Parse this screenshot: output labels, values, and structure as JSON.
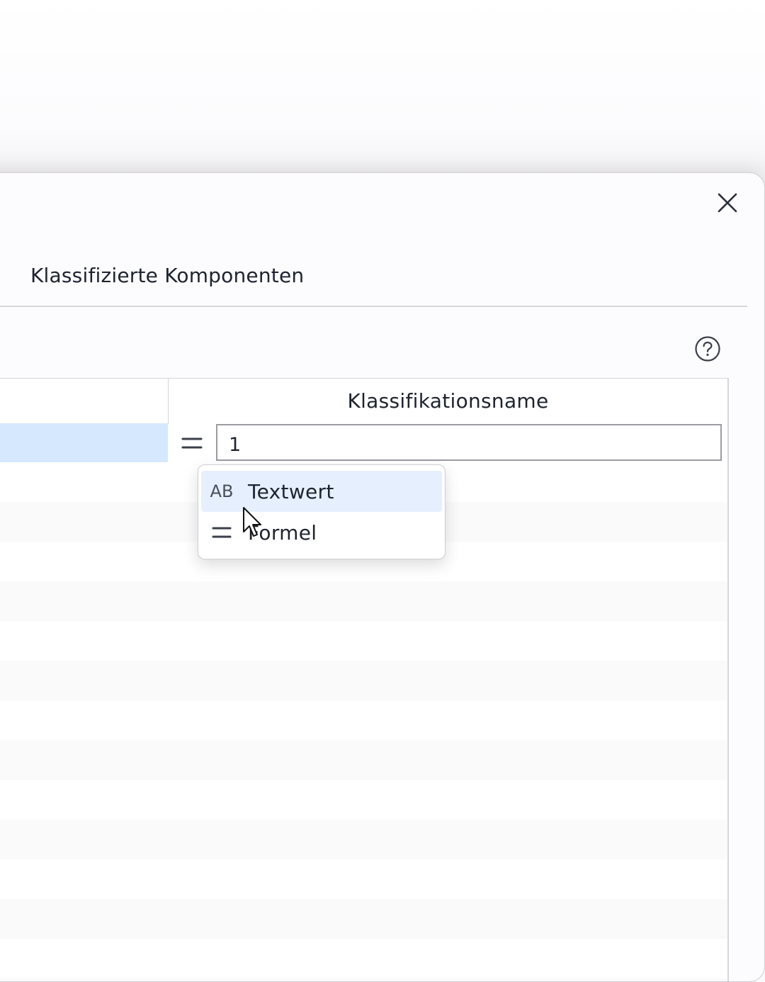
{
  "dialog": {
    "tab_title": "Klassifizierte Komponenten"
  },
  "table": {
    "column_header": "Klassifikationsname",
    "selected_row": {
      "value": "1"
    }
  },
  "dropdown": {
    "items": [
      {
        "icon_text": "AB",
        "label": "Textwert",
        "icon": "text-value-icon",
        "highlighted": true
      },
      {
        "icon_text": "",
        "label": "Formel",
        "icon": "equals-icon",
        "highlighted": false
      }
    ]
  },
  "colors": {
    "selection": "#d6e8fd",
    "hover": "#e6effd",
    "border": "#d6d5da",
    "text": "#1d2330"
  }
}
